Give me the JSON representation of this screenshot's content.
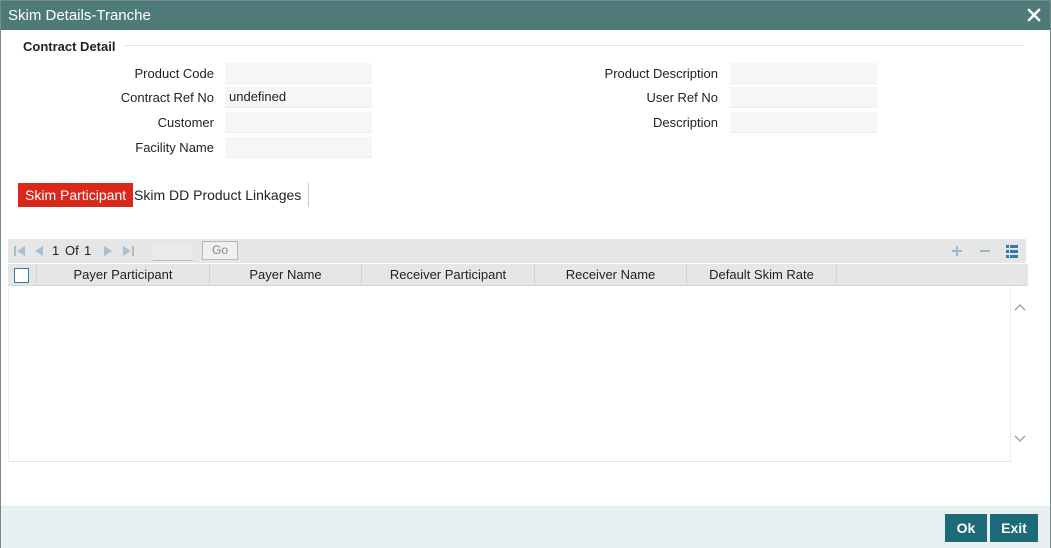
{
  "window": {
    "title": "Skim Details-Tranche"
  },
  "contract_detail": {
    "section_title": "Contract Detail",
    "product_code": {
      "label": "Product Code",
      "value": ""
    },
    "contract_ref_no": {
      "label": "Contract Ref No",
      "value": "undefined"
    },
    "customer": {
      "label": "Customer",
      "value": ""
    },
    "facility_name": {
      "label": "Facility Name",
      "value": ""
    },
    "product_description": {
      "label": "Product Description",
      "value": ""
    },
    "user_ref_no": {
      "label": "User Ref No",
      "value": ""
    },
    "description": {
      "label": "Description",
      "value": ""
    }
  },
  "tabs": [
    {
      "label": "Skim Participant",
      "active": true
    },
    {
      "label": "Skim DD Product Linkages",
      "active": false
    }
  ],
  "pager": {
    "current": "1",
    "of_label": "Of",
    "total": "1",
    "page_input": "",
    "go_label": "Go"
  },
  "grid": {
    "columns": [
      "Payer Participant",
      "Payer Name",
      "Receiver Participant",
      "Receiver Name",
      "Default Skim Rate"
    ],
    "rows": []
  },
  "footer": {
    "ok_label": "Ok",
    "exit_label": "Exit"
  },
  "colors": {
    "titlebar": "#4e7a7a",
    "active_tab": "#d9291c",
    "button": "#1d6b78"
  },
  "icons": [
    "close-icon",
    "first-page-icon",
    "prev-page-icon",
    "next-page-icon",
    "last-page-icon",
    "add-row-icon",
    "delete-row-icon",
    "single-view-icon",
    "scroll-up-icon",
    "scroll-down-icon"
  ]
}
